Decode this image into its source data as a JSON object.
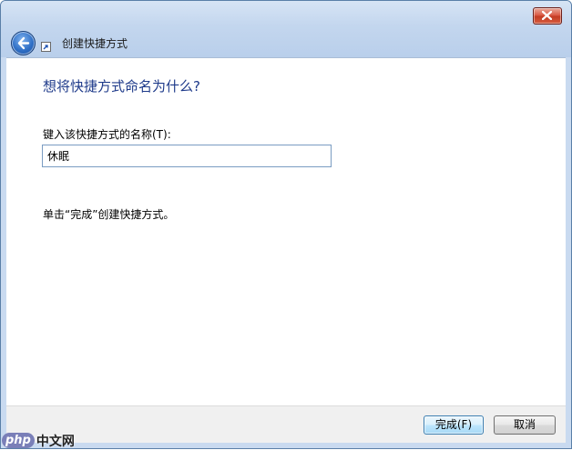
{
  "window": {
    "title": "创建快捷方式"
  },
  "titlebar": {
    "close_icon": "close-icon",
    "back_icon": "back-arrow-icon",
    "shortcut_icon": "shortcut-arrow-icon"
  },
  "main": {
    "heading": "想将快捷方式命名为什么?",
    "name_label": "键入该快捷方式的名称(T):",
    "name_value": "休眠",
    "hint": "单击“完成”创建快捷方式。"
  },
  "footer": {
    "finish_label": "完成(F)",
    "cancel_label": "取消"
  },
  "watermark": {
    "brand": "php",
    "site": "中文网"
  },
  "colors": {
    "heading": "#1e3a8a",
    "titlebar": "#c3d6ee",
    "close_button": "#c23a22",
    "default_button_border": "#3c7fb1"
  }
}
